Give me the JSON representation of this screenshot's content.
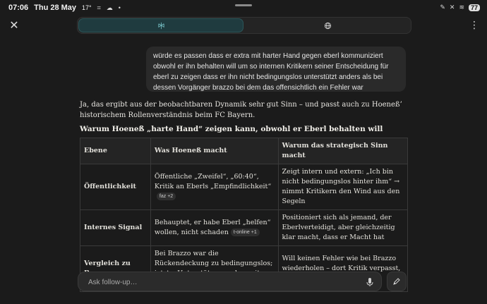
{
  "status": {
    "time": "07:06",
    "date": "Thu 28 May",
    "temp": "17°",
    "battery": "77"
  },
  "toolbar": {
    "close_icon": "close-icon",
    "more_icon": "more-vertical-icon"
  },
  "mode": {
    "seg1_icon": "perplexity-logo-icon",
    "seg2_icon": "globe-icon",
    "accent": "#1f3b3f"
  },
  "user_message": "würde es passen dass er extra mit harter Hand gegen eberl kommuniziert obwohl er ihn behalten will um so internen Kritikern seiner Entscheidung für eberl zu zeigen dass er ihn nicht bedingungslos unterstützt anders als bei dessen Vorgänger brazzo bei dem das offensichtlich ein Fehler war",
  "answer": {
    "intro": "Ja, das ergibt aus der beobachtbaren Dynamik sehr gut Sinn – und passt auch zu Hoeneß’ historischem Rollenverständnis beim FC Bayern.",
    "heading": "Warum Hoeneß „harte Hand“ zeigen kann, obwohl er Eberl behalten will",
    "table": {
      "headers": [
        "Ebene",
        "Was Hoeneß macht",
        "Warum das strategisch Sinn macht"
      ],
      "rows": [
        {
          "ebene": "Öffentlichkeit",
          "was": "Öffentliche „Zweifel“, „60:40“, Kritik an Eberls „Empfindlichkeit“",
          "cite": "faz +2",
          "warum": "Zeigt intern und extern: „Ich bin nicht bedingungslos hinter ihm“ → nimmt Kritikern den Wind aus den Segeln"
        },
        {
          "ebene": "Internes Signal",
          "was": "Behauptet, er habe Eberl „helfen“ wollen, nicht schaden",
          "cite": "t-online +1",
          "warum": "Positioniert sich als jemand, der Eberlverteidigt, aber gleichzeitig klar macht, dass er Macht hat"
        },
        {
          "ebene": "Vergleich zu Brazzo",
          "was": "Bei Brazzo war die Rückendeckung zu bedingungslos; jetzt: „Unterstützung, aber mit Druck“",
          "cite": "",
          "warum": "Will keinen Fehler wie bei Brazzo wiederholen – dort Kritik verpasst, jetzt früh Gegenwind zeigen"
        }
      ]
    }
  },
  "input": {
    "placeholder": "Ask follow-up…"
  }
}
